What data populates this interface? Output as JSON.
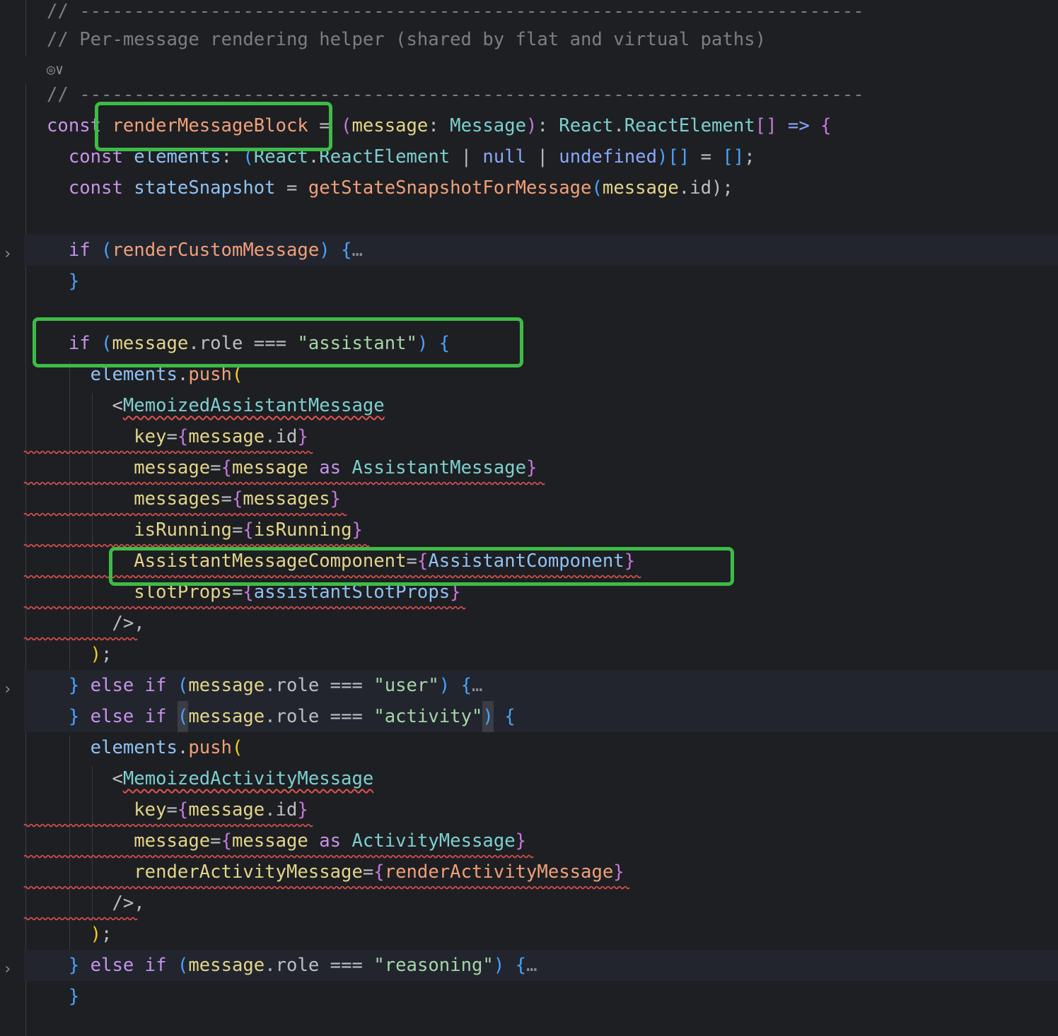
{
  "lines": [
    {
      "id": "l0",
      "hl": false,
      "tokens": [
        {
          "t": "// ------------------------------------------------------------------------",
          "c": "#7a7e85"
        }
      ]
    },
    {
      "id": "l1",
      "hl": false,
      "tokens": [
        {
          "t": "// Per-message rendering helper (shared by flat and virtual paths)",
          "c": "#7a7e85"
        }
      ]
    },
    {
      "id": "l3",
      "hl": false,
      "tokens": [
        {
          "t": "// ------------------------------------------------------------------------",
          "c": "#7a7e85"
        }
      ]
    },
    {
      "id": "l4",
      "hl": false,
      "tokens": [
        {
          "t": "const ",
          "c": "#c792ea"
        },
        {
          "t": "renderMessageBlock",
          "c": "#f0a07a"
        },
        {
          "t": " = ",
          "c": "#bcbec4"
        },
        {
          "t": "(",
          "c": "#c678dd"
        },
        {
          "t": "message",
          "c": "#e2d58a"
        },
        {
          "t": ": ",
          "c": "#bcbec4"
        },
        {
          "t": "Message",
          "c": "#7dcfd1"
        },
        {
          "t": ")",
          "c": "#c678dd"
        },
        {
          "t": ": ",
          "c": "#bcbec4"
        },
        {
          "t": "React",
          "c": "#7dcfd1"
        },
        {
          "t": ".",
          "c": "#bcbec4"
        },
        {
          "t": "ReactElement",
          "c": "#7dcfd1"
        },
        {
          "t": "[]",
          "c": "#c678dd"
        },
        {
          "t": " => ",
          "c": "#89a8ff"
        },
        {
          "t": "{",
          "c": "#c678dd"
        }
      ]
    },
    {
      "id": "l5",
      "hl": false,
      "tokens": [
        {
          "t": "  const ",
          "c": "#c792ea"
        },
        {
          "t": "elements",
          "c": "#8fc2f5"
        },
        {
          "t": ": ",
          "c": "#bcbec4"
        },
        {
          "t": "(",
          "c": "#4aa3ff"
        },
        {
          "t": "React",
          "c": "#7dcfd1"
        },
        {
          "t": ".",
          "c": "#bcbec4"
        },
        {
          "t": "ReactElement",
          "c": "#7dcfd1"
        },
        {
          "t": " | ",
          "c": "#bcbec4"
        },
        {
          "t": "null",
          "c": "#89a8ff"
        },
        {
          "t": " | ",
          "c": "#bcbec4"
        },
        {
          "t": "undefined",
          "c": "#89a8ff"
        },
        {
          "t": ")[]",
          "c": "#4aa3ff"
        },
        {
          "t": " = ",
          "c": "#bcbec4"
        },
        {
          "t": "[]",
          "c": "#4aa3ff"
        },
        {
          "t": ";",
          "c": "#bcbec4"
        }
      ]
    },
    {
      "id": "l6",
      "hl": false,
      "tokens": [
        {
          "t": "  const ",
          "c": "#c792ea"
        },
        {
          "t": "stateSnapshot",
          "c": "#8fc2f5"
        },
        {
          "t": " = ",
          "c": "#bcbec4"
        },
        {
          "t": "getStateSnapshotForMessage",
          "c": "#f0a07a"
        },
        {
          "t": "(",
          "c": "#4aa3ff"
        },
        {
          "t": "message",
          "c": "#e2d58a"
        },
        {
          "t": ".id",
          "c": "#bcbec4"
        },
        {
          "t": ");",
          "c": "#bcbec4"
        }
      ]
    },
    {
      "id": "l7",
      "hl": false,
      "tokens": []
    },
    {
      "id": "l8",
      "hl": true,
      "tokens": [
        {
          "t": "  if ",
          "c": "#c792ea"
        },
        {
          "t": "(",
          "c": "#4aa3ff"
        },
        {
          "t": "renderCustomMessage",
          "c": "#f0a07a"
        },
        {
          "t": ")",
          "c": "#4aa3ff"
        },
        {
          "t": " {",
          "c": "#4aa3ff"
        },
        {
          "t": "…",
          "c": "#8a8d93"
        }
      ]
    },
    {
      "id": "l9",
      "hl": false,
      "tokens": [
        {
          "t": "  }",
          "c": "#4aa3ff"
        }
      ]
    },
    {
      "id": "l10",
      "hl": false,
      "tokens": []
    },
    {
      "id": "l11",
      "hl": false,
      "tokens": [
        {
          "t": "  if ",
          "c": "#c792ea"
        },
        {
          "t": "(",
          "c": "#4aa3ff"
        },
        {
          "t": "message",
          "c": "#e2d58a"
        },
        {
          "t": ".role === ",
          "c": "#bcbec4"
        },
        {
          "t": "\"assistant\"",
          "c": "#a5d6a7"
        },
        {
          "t": ")",
          "c": "#4aa3ff"
        },
        {
          "t": " {",
          "c": "#4aa3ff"
        }
      ]
    },
    {
      "id": "l12",
      "hl": false,
      "tokens": [
        {
          "t": "    elements",
          "c": "#8fc2f5"
        },
        {
          "t": ".",
          "c": "#bcbec4"
        },
        {
          "t": "push",
          "c": "#f0a07a"
        },
        {
          "t": "(",
          "c": "#f5d020"
        }
      ]
    },
    {
      "id": "l13",
      "hl": false,
      "tokens": [
        {
          "t": "      <",
          "c": "#bcbec4"
        },
        {
          "t": "MemoizedAssistantMessage",
          "c": "#7dcfd1",
          "sq": true
        }
      ]
    },
    {
      "id": "l14",
      "hl": false,
      "tokens": [
        {
          "t": "        key",
          "c": "#e2d58a"
        },
        {
          "t": "=",
          "c": "#bcbec4"
        },
        {
          "t": "{",
          "c": "#c678dd"
        },
        {
          "t": "message",
          "c": "#e2d58a"
        },
        {
          "t": ".id",
          "c": "#bcbec4"
        },
        {
          "t": "}",
          "c": "#c678dd"
        }
      ]
    },
    {
      "id": "l15",
      "hl": false,
      "tokens": [
        {
          "t": "        message",
          "c": "#e2d58a"
        },
        {
          "t": "=",
          "c": "#bcbec4"
        },
        {
          "t": "{",
          "c": "#c678dd"
        },
        {
          "t": "message ",
          "c": "#e2d58a"
        },
        {
          "t": "as ",
          "c": "#c792ea"
        },
        {
          "t": "AssistantMessage",
          "c": "#7dcfd1"
        },
        {
          "t": "}",
          "c": "#c678dd"
        }
      ]
    },
    {
      "id": "l16",
      "hl": false,
      "tokens": [
        {
          "t": "        messages",
          "c": "#e2d58a"
        },
        {
          "t": "=",
          "c": "#bcbec4"
        },
        {
          "t": "{",
          "c": "#c678dd"
        },
        {
          "t": "messages",
          "c": "#e2d58a"
        },
        {
          "t": "}",
          "c": "#c678dd"
        }
      ]
    },
    {
      "id": "l17",
      "hl": false,
      "tokens": [
        {
          "t": "        isRunning",
          "c": "#e2d58a"
        },
        {
          "t": "=",
          "c": "#bcbec4"
        },
        {
          "t": "{",
          "c": "#c678dd"
        },
        {
          "t": "isRunning",
          "c": "#e2d58a"
        },
        {
          "t": "}",
          "c": "#c678dd"
        }
      ]
    },
    {
      "id": "l18",
      "hl": false,
      "tokens": [
        {
          "t": "        AssistantMessageComponent",
          "c": "#e2d58a"
        },
        {
          "t": "=",
          "c": "#bcbec4"
        },
        {
          "t": "{",
          "c": "#c678dd"
        },
        {
          "t": "AssistantComponent",
          "c": "#8fc2f5"
        },
        {
          "t": "}",
          "c": "#c678dd"
        }
      ]
    },
    {
      "id": "l19",
      "hl": false,
      "tokens": [
        {
          "t": "        slotProps",
          "c": "#e2d58a"
        },
        {
          "t": "=",
          "c": "#bcbec4"
        },
        {
          "t": "{",
          "c": "#c678dd"
        },
        {
          "t": "assistantSlotProps",
          "c": "#8fc2f5"
        },
        {
          "t": "}",
          "c": "#c678dd"
        }
      ]
    },
    {
      "id": "l20",
      "hl": false,
      "tokens": [
        {
          "t": "      />,",
          "c": "#bcbec4"
        }
      ]
    },
    {
      "id": "l21",
      "hl": false,
      "tokens": [
        {
          "t": "    )",
          "c": "#f5d020"
        },
        {
          "t": ";",
          "c": "#bcbec4"
        }
      ]
    },
    {
      "id": "l22",
      "hl": true,
      "tokens": [
        {
          "t": "  } ",
          "c": "#4aa3ff"
        },
        {
          "t": "else if ",
          "c": "#c792ea"
        },
        {
          "t": "(",
          "c": "#4aa3ff"
        },
        {
          "t": "message",
          "c": "#e2d58a"
        },
        {
          "t": ".role === ",
          "c": "#bcbec4"
        },
        {
          "t": "\"user\"",
          "c": "#a5d6a7"
        },
        {
          "t": ")",
          "c": "#4aa3ff"
        },
        {
          "t": " {",
          "c": "#4aa3ff"
        },
        {
          "t": "…",
          "c": "#8a8d93"
        }
      ]
    },
    {
      "id": "l23",
      "hl": true,
      "tokens": [
        {
          "t": "  } ",
          "c": "#4aa3ff"
        },
        {
          "t": "else if ",
          "c": "#c792ea"
        },
        {
          "t": "(",
          "c": "#4aa3ff",
          "caret": true
        },
        {
          "t": "message",
          "c": "#e2d58a"
        },
        {
          "t": ".role === ",
          "c": "#bcbec4"
        },
        {
          "t": "\"activity\"",
          "c": "#a5d6a7"
        },
        {
          "t": ")",
          "c": "#4aa3ff",
          "caret": true
        },
        {
          "t": " {",
          "c": "#4aa3ff"
        }
      ]
    },
    {
      "id": "l24",
      "hl": false,
      "tokens": [
        {
          "t": "    elements",
          "c": "#8fc2f5"
        },
        {
          "t": ".",
          "c": "#bcbec4"
        },
        {
          "t": "push",
          "c": "#f0a07a"
        },
        {
          "t": "(",
          "c": "#f5d020"
        }
      ]
    },
    {
      "id": "l25",
      "hl": false,
      "tokens": [
        {
          "t": "      <",
          "c": "#bcbec4"
        },
        {
          "t": "MemoizedActivityMessage",
          "c": "#7dcfd1",
          "sq": true
        }
      ]
    },
    {
      "id": "l26",
      "hl": false,
      "tokens": [
        {
          "t": "        key",
          "c": "#e2d58a"
        },
        {
          "t": "=",
          "c": "#bcbec4"
        },
        {
          "t": "{",
          "c": "#c678dd"
        },
        {
          "t": "message",
          "c": "#e2d58a"
        },
        {
          "t": ".id",
          "c": "#bcbec4"
        },
        {
          "t": "}",
          "c": "#c678dd"
        }
      ]
    },
    {
      "id": "l27",
      "hl": false,
      "tokens": [
        {
          "t": "        message",
          "c": "#e2d58a"
        },
        {
          "t": "=",
          "c": "#bcbec4"
        },
        {
          "t": "{",
          "c": "#c678dd"
        },
        {
          "t": "message ",
          "c": "#e2d58a"
        },
        {
          "t": "as ",
          "c": "#c792ea"
        },
        {
          "t": "ActivityMessage",
          "c": "#7dcfd1"
        },
        {
          "t": "}",
          "c": "#c678dd"
        }
      ]
    },
    {
      "id": "l28",
      "hl": false,
      "tokens": [
        {
          "t": "        renderActivityMessage",
          "c": "#e2d58a"
        },
        {
          "t": "=",
          "c": "#bcbec4"
        },
        {
          "t": "{",
          "c": "#c678dd"
        },
        {
          "t": "renderActivityMessage",
          "c": "#f0a07a"
        },
        {
          "t": "}",
          "c": "#c678dd"
        }
      ]
    },
    {
      "id": "l29",
      "hl": false,
      "tokens": [
        {
          "t": "      />,",
          "c": "#bcbec4"
        }
      ]
    },
    {
      "id": "l30",
      "hl": false,
      "tokens": [
        {
          "t": "    )",
          "c": "#f5d020"
        },
        {
          "t": ";",
          "c": "#bcbec4"
        }
      ]
    },
    {
      "id": "l31",
      "hl": true,
      "tokens": [
        {
          "t": "  } ",
          "c": "#4aa3ff"
        },
        {
          "t": "else if ",
          "c": "#c792ea"
        },
        {
          "t": "(",
          "c": "#4aa3ff"
        },
        {
          "t": "message",
          "c": "#e2d58a"
        },
        {
          "t": ".role === ",
          "c": "#bcbec4"
        },
        {
          "t": "\"reasoning\"",
          "c": "#a5d6a7"
        },
        {
          "t": ")",
          "c": "#4aa3ff"
        },
        {
          "t": " {",
          "c": "#4aa3ff"
        },
        {
          "t": "…",
          "c": "#8a8d93"
        }
      ]
    },
    {
      "id": "l32",
      "hl": false,
      "tokens": [
        {
          "t": "  }",
          "c": "#4aa3ff"
        }
      ]
    }
  ],
  "inlay_hint_icon": "ai-assist-icon",
  "fold_icon": "chevron-right-icon",
  "colors": {
    "background": "#1e1f22",
    "highlight": "#22252e",
    "annotation_box": "#3dbb46",
    "squiggle": "#e05252"
  }
}
